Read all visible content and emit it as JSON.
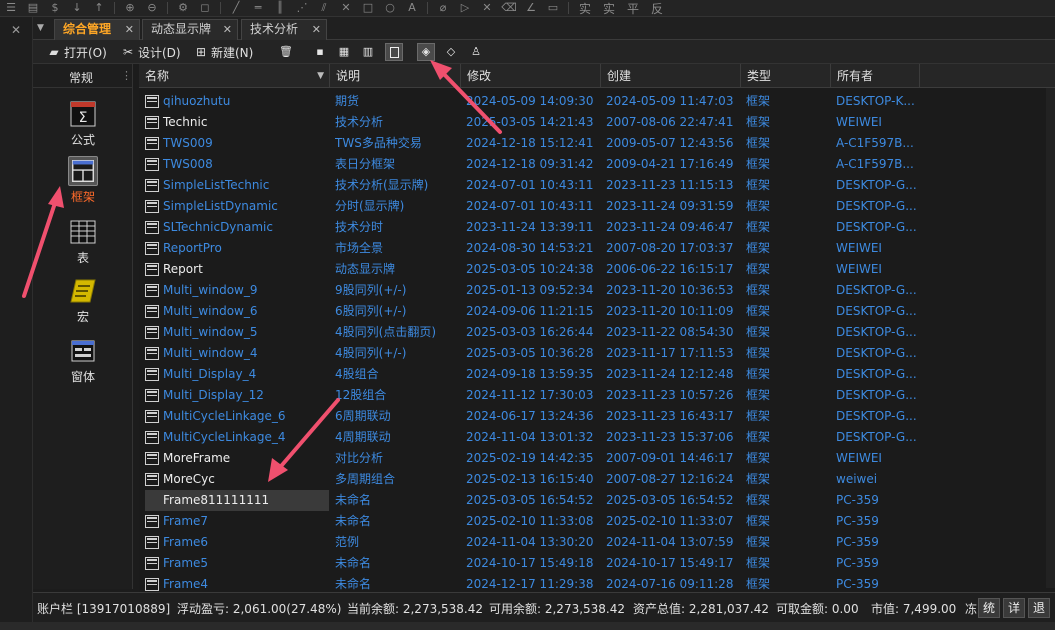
{
  "toolbar": {
    "text_buttons": [
      "实",
      "实",
      "平",
      "反"
    ]
  },
  "tabs": [
    {
      "label": "综合管理",
      "active": true
    },
    {
      "label": "动态显示牌",
      "active": false
    },
    {
      "label": "技术分析",
      "active": false
    }
  ],
  "actions": {
    "open": "打开(O)",
    "design": "设计(D)",
    "new": "新建(N)"
  },
  "sidebar": {
    "title": "常规",
    "items": [
      {
        "label": "公式",
        "icon": "formula-icon",
        "selected": false
      },
      {
        "label": "框架",
        "icon": "frame-icon",
        "selected": true
      },
      {
        "label": "表",
        "icon": "table-icon",
        "selected": false
      },
      {
        "label": "宏",
        "icon": "macro-icon",
        "selected": false
      },
      {
        "label": "窗体",
        "icon": "form-icon",
        "selected": false
      }
    ]
  },
  "table": {
    "columns": [
      "名称",
      "说明",
      "修改",
      "创建",
      "类型",
      "所有者"
    ],
    "rows": [
      {
        "name": "qihuozhutu",
        "desc": "期货",
        "modified": "2024-05-09 14:09:30",
        "created": "2024-05-09 11:47:03",
        "type": "框架",
        "owner": "DESKTOP-K...",
        "color": "blue"
      },
      {
        "name": "Technic",
        "desc": "技术分析",
        "modified": "2025-03-05 14:21:43",
        "created": "2007-08-06 22:47:41",
        "type": "框架",
        "owner": "WEIWEI",
        "color": "white"
      },
      {
        "name": "TWS009",
        "desc": "TWS多品种交易",
        "modified": "2024-12-18 15:12:41",
        "created": "2009-05-07 12:43:56",
        "type": "框架",
        "owner": "A-C1F597B...",
        "color": "blue"
      },
      {
        "name": "TWS008",
        "desc": "表日分框架",
        "modified": "2024-12-18 09:31:42",
        "created": "2009-04-21 17:16:49",
        "type": "框架",
        "owner": "A-C1F597B...",
        "color": "blue"
      },
      {
        "name": "SimpleListTechnic",
        "desc": "技术分析(显示牌)",
        "modified": "2024-07-01 10:43:11",
        "created": "2023-11-23 11:15:13",
        "type": "框架",
        "owner": "DESKTOP-G...",
        "color": "blue"
      },
      {
        "name": "SimpleListDynamic",
        "desc": "分时(显示牌)",
        "modified": "2024-07-01 10:43:11",
        "created": "2023-11-24 09:31:59",
        "type": "框架",
        "owner": "DESKTOP-G...",
        "color": "blue"
      },
      {
        "name": "SLTechnicDynamic",
        "desc": "技术分时",
        "modified": "2023-11-24 13:39:11",
        "created": "2023-11-24 09:46:47",
        "type": "框架",
        "owner": "DESKTOP-G...",
        "color": "blue"
      },
      {
        "name": "ReportPro",
        "desc": "市场全景",
        "modified": "2024-08-30 14:53:21",
        "created": "2007-08-20 17:03:37",
        "type": "框架",
        "owner": "WEIWEI",
        "color": "blue"
      },
      {
        "name": "Report",
        "desc": "动态显示牌",
        "modified": "2025-03-05 10:24:38",
        "created": "2006-06-22 16:15:17",
        "type": "框架",
        "owner": "WEIWEI",
        "color": "white"
      },
      {
        "name": "Multi_window_9",
        "desc": "9股同列(+/-)",
        "modified": "2025-01-13 09:52:34",
        "created": "2023-11-20 10:36:53",
        "type": "框架",
        "owner": "DESKTOP-G...",
        "color": "blue"
      },
      {
        "name": "Multi_window_6",
        "desc": "6股同列(+/-)",
        "modified": "2024-09-06 11:21:15",
        "created": "2023-11-20 10:11:09",
        "type": "框架",
        "owner": "DESKTOP-G...",
        "color": "blue"
      },
      {
        "name": "Multi_window_5",
        "desc": "4股同列(点击翻页)",
        "modified": "2025-03-03 16:26:44",
        "created": "2023-11-22 08:54:30",
        "type": "框架",
        "owner": "DESKTOP-G...",
        "color": "blue"
      },
      {
        "name": "Multi_window_4",
        "desc": "4股同列(+/-)",
        "modified": "2025-03-05 10:36:28",
        "created": "2023-11-17 17:11:53",
        "type": "框架",
        "owner": "DESKTOP-G...",
        "color": "blue"
      },
      {
        "name": "Multi_Display_4",
        "desc": "4股组合",
        "modified": "2024-09-18 13:59:35",
        "created": "2023-11-24 12:12:48",
        "type": "框架",
        "owner": "DESKTOP-G...",
        "color": "blue"
      },
      {
        "name": "Multi_Display_12",
        "desc": "12股组合",
        "modified": "2024-11-12 17:30:03",
        "created": "2023-11-23 10:57:26",
        "type": "框架",
        "owner": "DESKTOP-G...",
        "color": "blue"
      },
      {
        "name": "MultiCycleLinkage_6",
        "desc": "6周期联动",
        "modified": "2024-06-17 13:24:36",
        "created": "2023-11-23 16:43:17",
        "type": "框架",
        "owner": "DESKTOP-G...",
        "color": "blue"
      },
      {
        "name": "MultiCycleLinkage_4",
        "desc": "4周期联动",
        "modified": "2024-11-04 13:01:32",
        "created": "2023-11-23 15:37:06",
        "type": "框架",
        "owner": "DESKTOP-G...",
        "color": "blue"
      },
      {
        "name": "MoreFrame",
        "desc": "对比分析",
        "modified": "2025-02-19 14:42:35",
        "created": "2007-09-01 14:46:17",
        "type": "框架",
        "owner": "WEIWEI",
        "color": "white"
      },
      {
        "name": "MoreCyc",
        "desc": "多周期组合",
        "modified": "2025-02-13 16:15:40",
        "created": "2007-08-27 12:16:24",
        "type": "框架",
        "owner": "weiwei",
        "color": "white"
      },
      {
        "name": "Frame811111111",
        "desc": "未命名",
        "modified": "2025-03-05 16:54:52",
        "created": "2025-03-05 16:54:52",
        "type": "框架",
        "owner": "PC-359",
        "color": "white",
        "selected": true
      },
      {
        "name": "Frame7",
        "desc": "未命名",
        "modified": "2025-02-10 11:33:08",
        "created": "2025-02-10 11:33:07",
        "type": "框架",
        "owner": "PC-359",
        "color": "blue"
      },
      {
        "name": "Frame6",
        "desc": "范例",
        "modified": "2024-11-04 13:30:20",
        "created": "2024-11-04 13:07:59",
        "type": "框架",
        "owner": "PC-359",
        "color": "blue"
      },
      {
        "name": "Frame5",
        "desc": "未命名",
        "modified": "2024-10-17 15:49:18",
        "created": "2024-10-17 15:49:17",
        "type": "框架",
        "owner": "PC-359",
        "color": "blue"
      },
      {
        "name": "Frame4",
        "desc": "未命名",
        "modified": "2024-12-17 11:29:38",
        "created": "2024-07-16 09:11:28",
        "type": "框架",
        "owner": "PC-359",
        "color": "blue"
      }
    ]
  },
  "status": {
    "account": "账户栏 [13917010889]",
    "floating_pl": "浮动盈亏: 2,061.00(27.48%)",
    "balance": "当前余额: 2,273,538.42",
    "available": "可用余额: 2,273,538.42",
    "total_assets": "资产总值: 2,281,037.42",
    "withdrawable": "可取金额: 0.00",
    "market_value": "市值: 7,499.00",
    "btn_freeze": "冻",
    "btn_stats": "统",
    "btn_detail": "详",
    "btn_exit": "退"
  },
  "colors": {
    "accent_orange": "#ffa726",
    "selected_label": "#ff6a2a",
    "link_blue": "#3d8ae0",
    "annotation_red": "#f0506e"
  }
}
